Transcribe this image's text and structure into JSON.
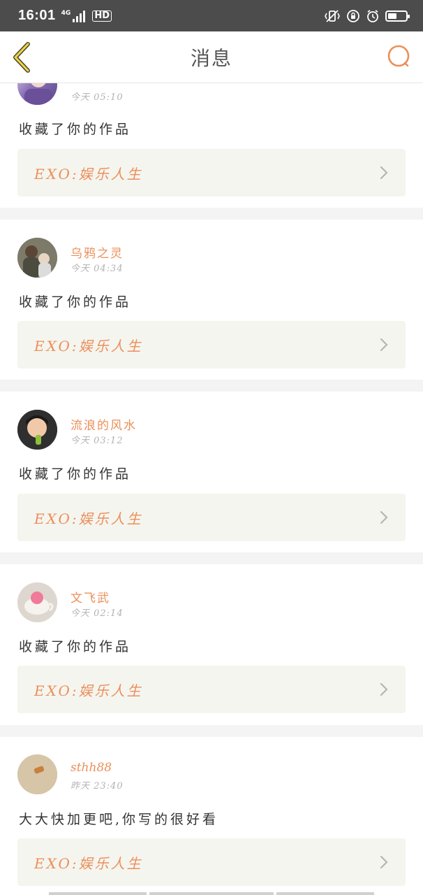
{
  "status_bar": {
    "time": "16:01",
    "network": "4G",
    "hd_badge": "HD",
    "battery_level": 0.5
  },
  "nav": {
    "title": "消息",
    "icon_back": "chevron-left-icon",
    "icon_search": "search-icon",
    "accent_color": "#eb8f5a"
  },
  "notifications": [
    {
      "username": "",
      "time": "今天 05:10",
      "message": "收藏了你的作品",
      "work_title": "EXO:娱乐人生"
    },
    {
      "username": "乌鸦之灵",
      "time": "今天 04:34",
      "message": "收藏了你的作品",
      "work_title": "EXO:娱乐人生"
    },
    {
      "username": "流浪的风水",
      "time": "今天 03:12",
      "message": "收藏了你的作品",
      "work_title": "EXO:娱乐人生"
    },
    {
      "username": "文飞武",
      "time": "今天 02:14",
      "message": "收藏了你的作品",
      "work_title": "EXO:娱乐人生"
    },
    {
      "username": "sthh88",
      "time": "昨天 23:40",
      "message": "大大快加更吧,你写的很好看",
      "work_title": "EXO:娱乐人生"
    }
  ]
}
